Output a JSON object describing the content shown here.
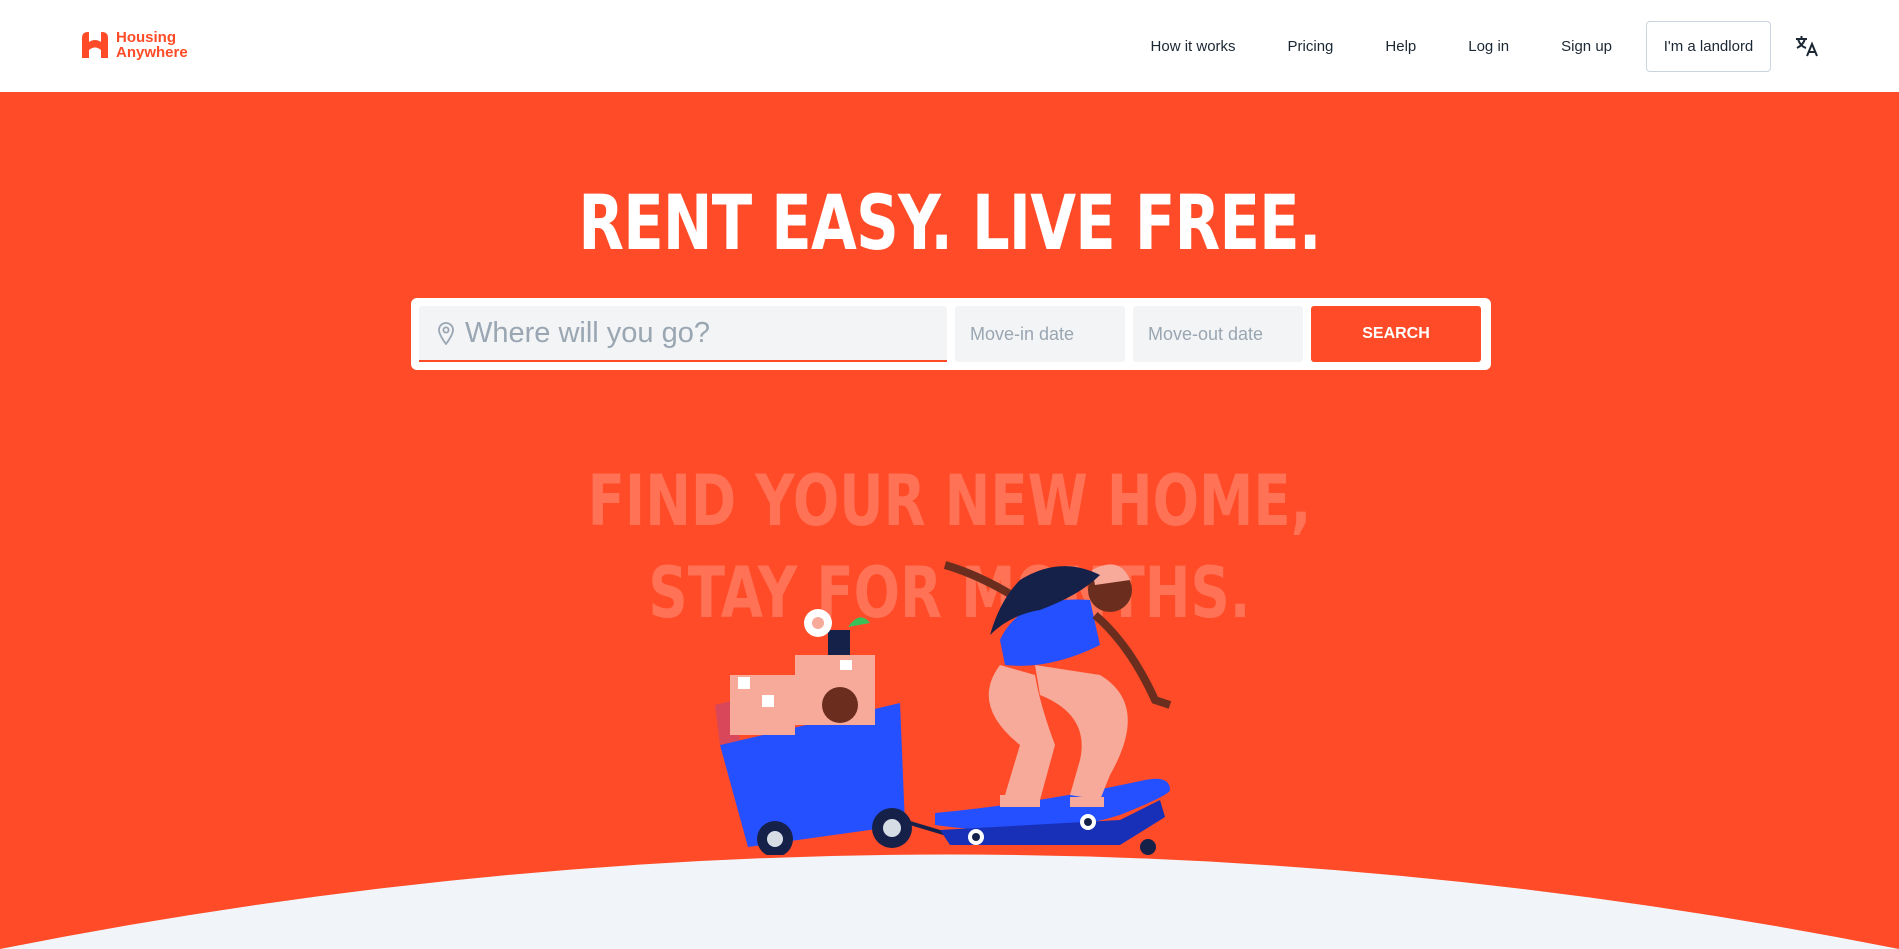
{
  "header": {
    "logo_line1": "Housing",
    "logo_line2": "Anywhere",
    "nav": [
      {
        "label": "How it works"
      },
      {
        "label": "Pricing"
      },
      {
        "label": "Help"
      },
      {
        "label": "Log in"
      },
      {
        "label": "Sign up"
      }
    ],
    "landlord_label": "I'm a landlord",
    "language_icon": "translate-icon"
  },
  "hero": {
    "title": "RENT EASY. LIVE FREE.",
    "tagline_line1": "FIND YOUR NEW HOME,",
    "tagline_line2": "STAY FOR MONTHS."
  },
  "search": {
    "location_placeholder": "Where will you go?",
    "movein_placeholder": "Move-in date",
    "moveout_placeholder": "Move-out date",
    "button_label": "SEARCH"
  },
  "colors": {
    "brand": "#ff4b27",
    "tagline": "#ff7256",
    "ground": "#f1f5f9",
    "text_dark": "#1b2733"
  }
}
